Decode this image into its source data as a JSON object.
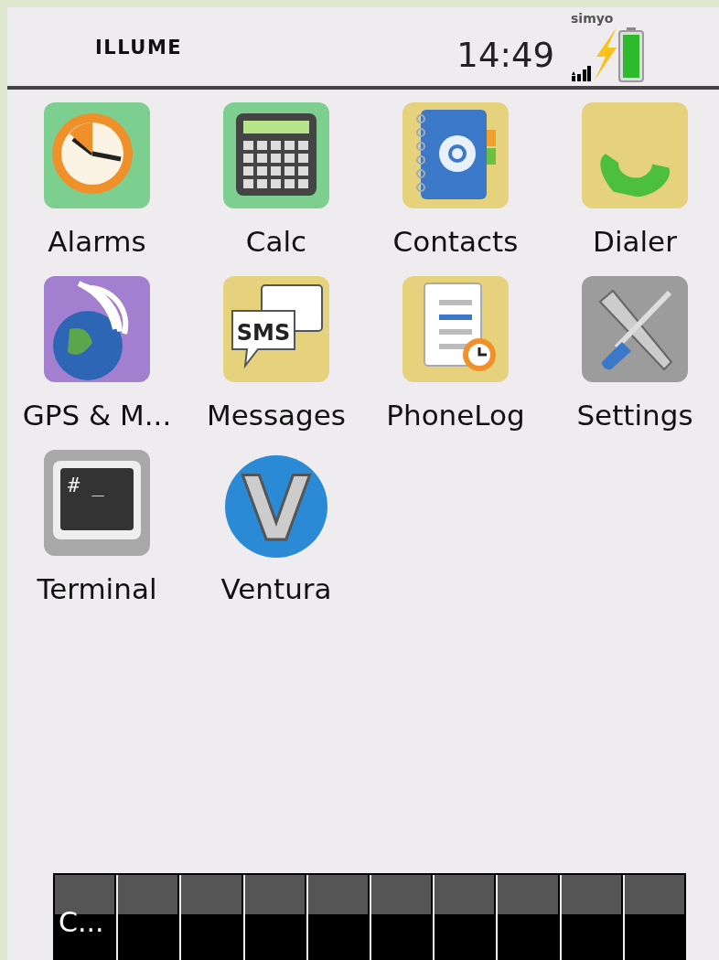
{
  "status_bar": {
    "title": "ILLUME",
    "time": "14:49",
    "carrier": "simyo"
  },
  "apps": [
    {
      "label": "Alarms"
    },
    {
      "label": "Calc"
    },
    {
      "label": "Contacts"
    },
    {
      "label": "Dialer"
    },
    {
      "label": "GPS & M..."
    },
    {
      "label": "Messages",
      "icon_text": "SMS"
    },
    {
      "label": "PhoneLog"
    },
    {
      "label": "Settings"
    },
    {
      "label": "Terminal",
      "icon_text": "# _"
    },
    {
      "label": "Ventura",
      "icon_text": "V"
    }
  ],
  "taskbar": {
    "items": [
      "C..."
    ]
  }
}
